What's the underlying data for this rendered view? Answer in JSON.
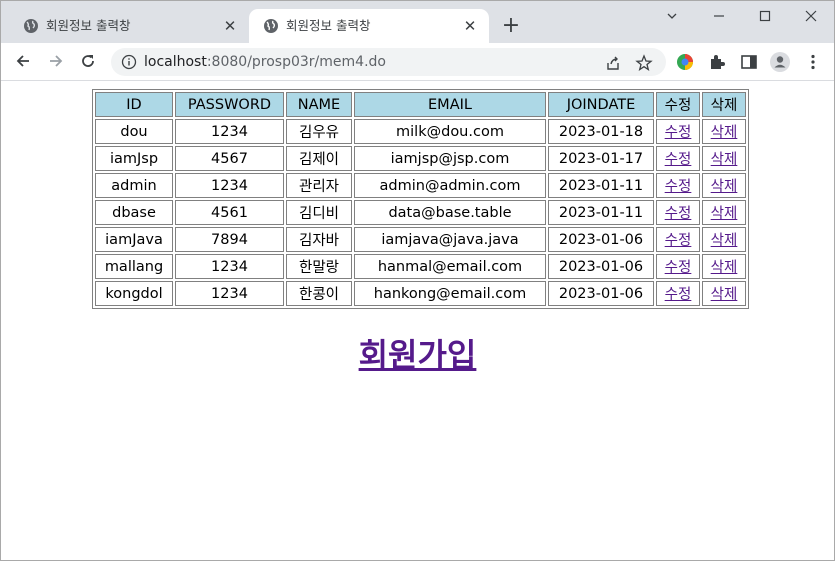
{
  "browser": {
    "tabs": [
      {
        "title": "회원정보 출력창",
        "active": false
      },
      {
        "title": "회원정보 출력창",
        "active": true
      }
    ],
    "url_host": "localhost",
    "url_rest": ":8080/prosp03r/mem4.do",
    "new_tab_label": "+"
  },
  "table": {
    "headers": [
      "ID",
      "PASSWORD",
      "NAME",
      "EMAIL",
      "JOINDATE",
      "수정",
      "삭제"
    ],
    "edit_link": "수정",
    "delete_link": "삭제",
    "rows": [
      {
        "id": "dou",
        "password": "1234",
        "name": "김우유",
        "email": "milk@dou.com",
        "joindate": "2023-01-18"
      },
      {
        "id": "iamJsp",
        "password": "4567",
        "name": "김제이",
        "email": "iamjsp@jsp.com",
        "joindate": "2023-01-17"
      },
      {
        "id": "admin",
        "password": "1234",
        "name": "관리자",
        "email": "admin@admin.com",
        "joindate": "2023-01-11"
      },
      {
        "id": "dbase",
        "password": "4561",
        "name": "김디비",
        "email": "data@base.table",
        "joindate": "2023-01-11"
      },
      {
        "id": "iamJava",
        "password": "7894",
        "name": "김자바",
        "email": "iamjava@java.java",
        "joindate": "2023-01-06"
      },
      {
        "id": "mallang",
        "password": "1234",
        "name": "한말랑",
        "email": "hanmal@email.com",
        "joindate": "2023-01-06"
      },
      {
        "id": "kongdol",
        "password": "1234",
        "name": "한콩이",
        "email": "hankong@email.com",
        "joindate": "2023-01-06"
      }
    ]
  },
  "join_link": "회원가입",
  "colors": {
    "header_bg": "#add8e6",
    "link": "#551a8b",
    "tabstrip": "#dee1e6"
  }
}
